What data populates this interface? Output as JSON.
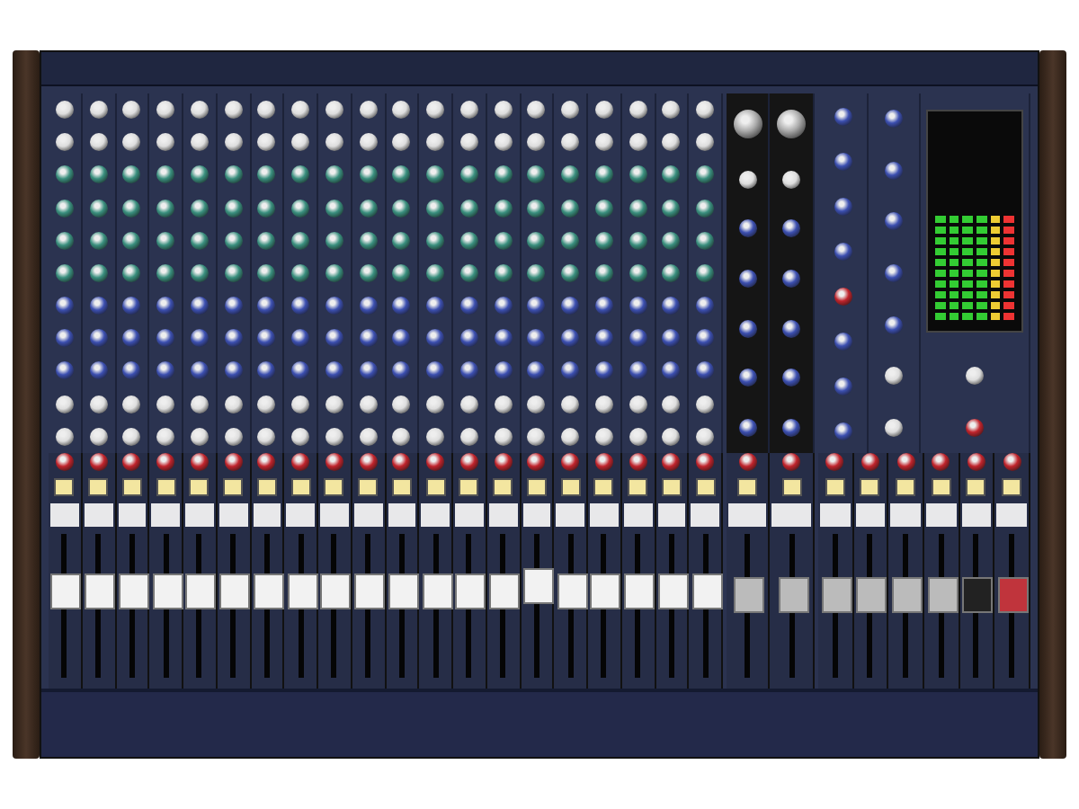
{
  "mixer": {
    "strips": [
      {
        "kind": "mono",
        "level": 0.6
      },
      {
        "kind": "mono",
        "level": 0.6
      },
      {
        "kind": "mono",
        "level": 0.6
      },
      {
        "kind": "mono",
        "level": 0.6
      },
      {
        "kind": "mono",
        "level": 0.6
      },
      {
        "kind": "mono",
        "level": 0.6
      },
      {
        "kind": "mono",
        "level": 0.6
      },
      {
        "kind": "mono",
        "level": 0.6
      },
      {
        "kind": "mono",
        "level": 0.6
      },
      {
        "kind": "mono",
        "level": 0.6
      },
      {
        "kind": "mono",
        "level": 0.6
      },
      {
        "kind": "mono",
        "level": 0.6
      },
      {
        "kind": "mono",
        "level": 0.6
      },
      {
        "kind": "mono",
        "level": 0.6
      },
      {
        "kind": "mono",
        "level": 0.64
      },
      {
        "kind": "mono",
        "level": 0.6
      },
      {
        "kind": "stereo",
        "level": 0.6
      },
      {
        "kind": "stereo",
        "level": 0.6
      },
      {
        "kind": "stereo",
        "level": 0.6
      },
      {
        "kind": "stereo",
        "level": 0.6
      },
      {
        "kind": "fx_return",
        "level": 0.58
      },
      {
        "kind": "fx_return",
        "level": 0.58
      },
      {
        "kind": "group",
        "level": 0.58
      },
      {
        "kind": "group",
        "level": 0.58
      },
      {
        "kind": "group",
        "level": 0.58
      },
      {
        "kind": "group",
        "level": 0.58
      },
      {
        "kind": "mono_out",
        "level": 0.58
      },
      {
        "kind": "stereo_out",
        "level": 0.58
      }
    ]
  }
}
